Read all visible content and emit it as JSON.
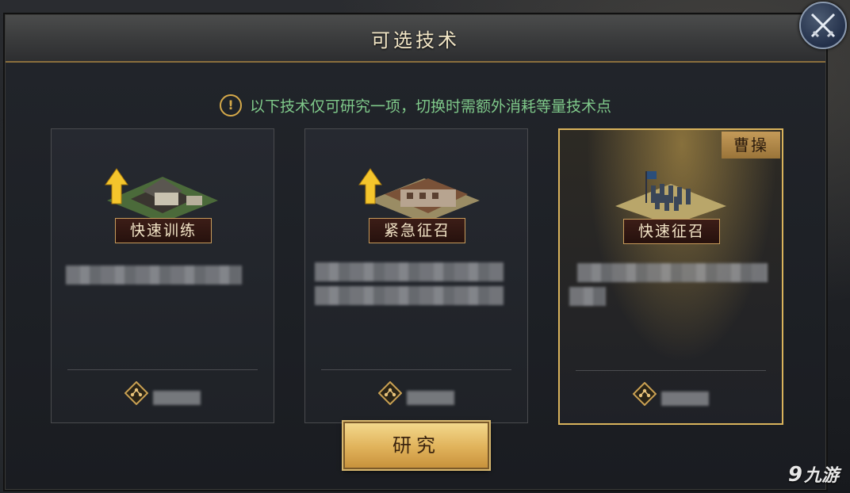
{
  "dialog": {
    "title": "可选技术",
    "notice": "以下技术仅可研究一项，切换时需额外消耗等量技术点",
    "notice_icon": "!",
    "research_button": "研究"
  },
  "options": [
    {
      "name": "快速训练",
      "image": "building-upgrade-icon",
      "selected": false
    },
    {
      "name": "紧急征召",
      "image": "fortress-upgrade-icon",
      "selected": false
    },
    {
      "name": "快速征召",
      "image": "army-formation-icon",
      "selected": true,
      "tag": "曹操"
    }
  ],
  "watermark": {
    "logo": "9",
    "text": "九游"
  },
  "colors": {
    "accent_gold": "#d9b35c",
    "notice_green": "#7fc98a",
    "label_red": "#3c1d17"
  }
}
